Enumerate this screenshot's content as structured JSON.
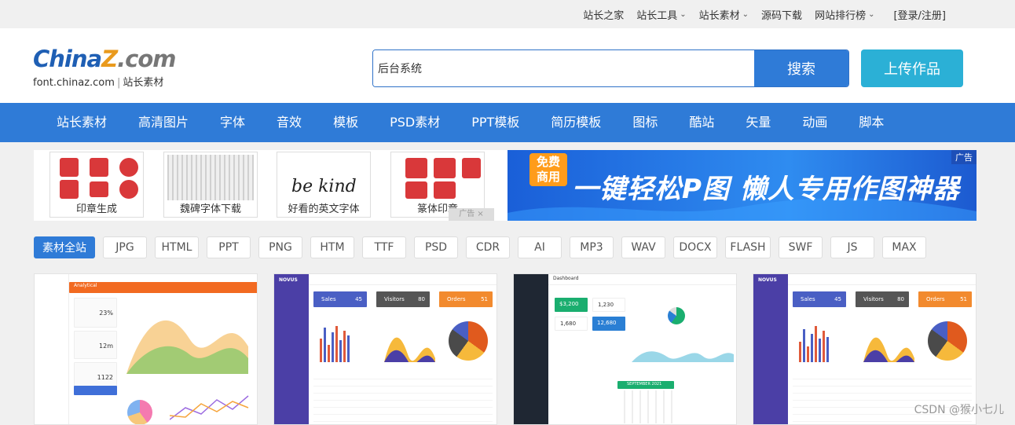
{
  "topbar": {
    "links": [
      {
        "label": "站长之家",
        "dropdown": false
      },
      {
        "label": "站长工具",
        "dropdown": true
      },
      {
        "label": "站长素材",
        "dropdown": true
      },
      {
        "label": "源码下载",
        "dropdown": false
      },
      {
        "label": "网站排行榜",
        "dropdown": true
      }
    ],
    "login": "[登录/注册]"
  },
  "logo": {
    "part1": "China",
    "part2": "Z",
    "part3": ".com",
    "domain": "font.chinaz.com",
    "tagline": "站长素材"
  },
  "search": {
    "value": "后台系统",
    "button": "搜索"
  },
  "upload_button": "上传作品",
  "nav": [
    "站长素材",
    "高清图片",
    "字体",
    "音效",
    "模板",
    "PSD素材",
    "PPT模板",
    "简历模板",
    "图标",
    "酷站",
    "矢量",
    "动画",
    "脚本"
  ],
  "banner": {
    "thumbs": [
      "印章生成",
      "魏碑字体下载",
      "好看的英文字体",
      "篆体印章"
    ],
    "script_sample": "be kind",
    "ad_close_tag": "广告 ×",
    "ad": {
      "badge": "免费\n商用",
      "text": "一键轻松P图 懒人专用作图神器",
      "label": "广告"
    }
  },
  "tags": [
    "素材全站",
    "JPG",
    "HTML",
    "PPT",
    "PNG",
    "HTM",
    "TTF",
    "PSD",
    "CDR",
    "AI",
    "MP3",
    "WAV",
    "DOCX",
    "FLASH",
    "SWF",
    "JS",
    "MAX"
  ],
  "cards": [
    {
      "title": "Analytical",
      "stats": [
        "23%",
        "12m",
        "1122"
      ]
    },
    {
      "title": "NOVUS",
      "stats": [
        "Sales",
        "Visitors",
        "Orders"
      ],
      "numbers": [
        "45",
        "80",
        "51"
      ]
    },
    {
      "title": "Dashboard",
      "stats": [
        "$3,200",
        "1,230",
        "1,680",
        "12,680"
      ],
      "calendar": "SEPTEMBER 2021"
    },
    {
      "title": "NOVUS",
      "stats": [
        "Sales",
        "Visitors",
        "Orders"
      ],
      "numbers": [
        "45",
        "80",
        "51"
      ]
    }
  ],
  "watermark": "CSDN @猴小七儿",
  "colors": {
    "primary": "#2f7bd7",
    "upload": "#2bb0d6",
    "sidebar_purple": "#4b3fa6",
    "sidebar_dark": "#1f2733",
    "orange": "#f28a2e"
  }
}
